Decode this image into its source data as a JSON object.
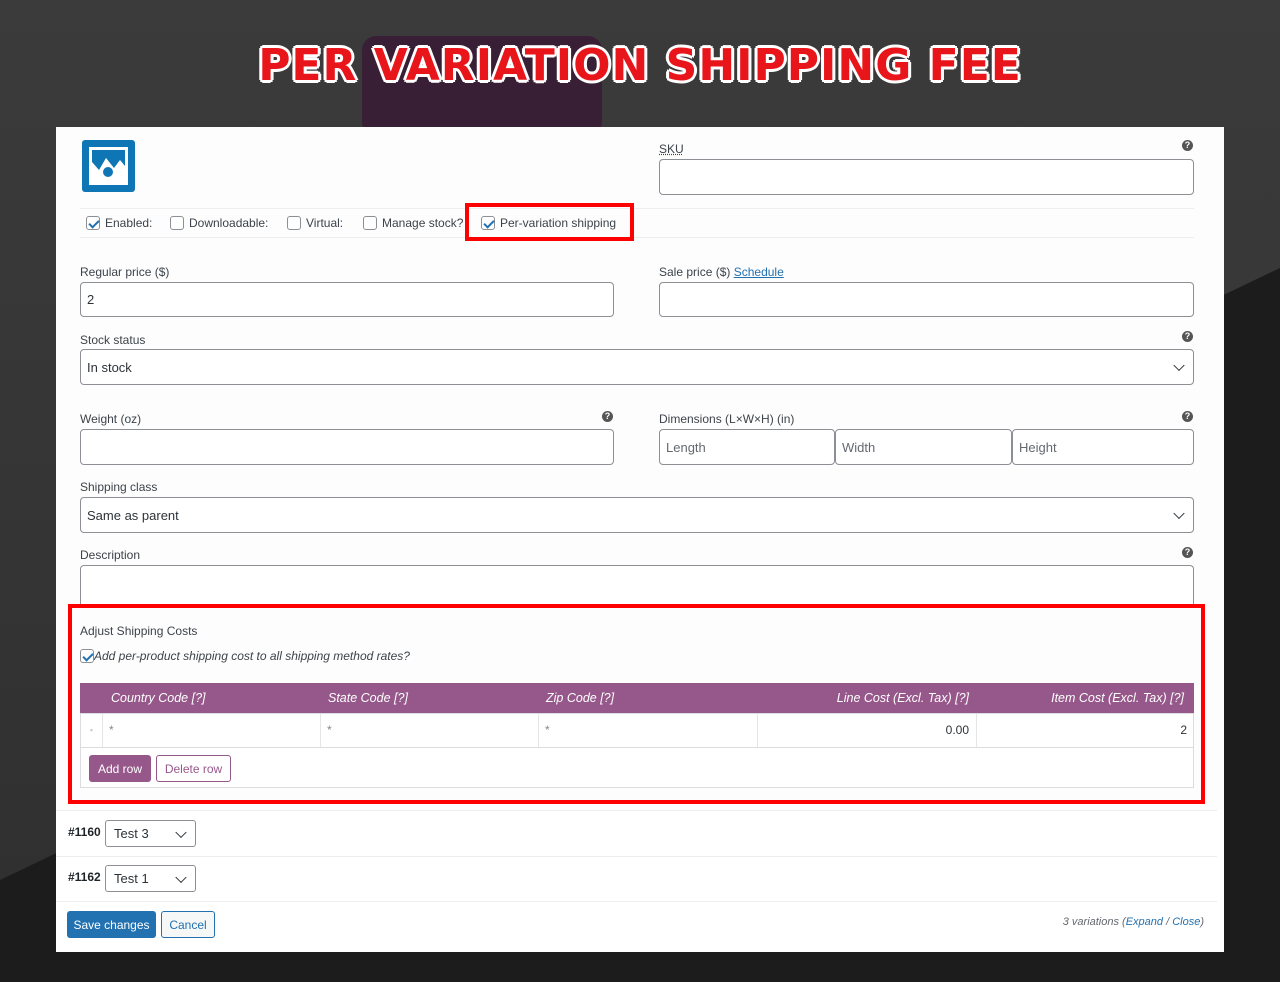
{
  "banner": {
    "title": "PER VARIATION SHIPPING FEE"
  },
  "colors": {
    "accent_red": "#ff0000",
    "woo_purple": "#96588a",
    "wp_blue": "#2271b1"
  },
  "icons": {
    "image_placeholder": "image-placeholder-icon",
    "help": "help-icon",
    "chevron": "chevron-down-icon",
    "drag": "drag-handle-icon"
  },
  "sku": {
    "label": "SKU",
    "value": ""
  },
  "checkboxes": {
    "enabled": {
      "label": "Enabled:",
      "checked": true
    },
    "downloadable": {
      "label": "Downloadable:",
      "checked": false
    },
    "virtual": {
      "label": "Virtual:",
      "checked": false
    },
    "manage_stock": {
      "label": "Manage stock?",
      "checked": false
    },
    "per_variation_shipping": {
      "label": "Per-variation shipping",
      "checked": true
    }
  },
  "regular_price": {
    "label": "Regular price ($)",
    "value": "2"
  },
  "sale_price": {
    "label": "Sale price ($)",
    "schedule_link": "Schedule",
    "value": ""
  },
  "stock_status": {
    "label": "Stock status",
    "value": "In stock"
  },
  "weight": {
    "label": "Weight (oz)",
    "value": ""
  },
  "dimensions": {
    "label": "Dimensions (L×W×H) (in)",
    "length_placeholder": "Length",
    "width_placeholder": "Width",
    "height_placeholder": "Height"
  },
  "shipping_class": {
    "label": "Shipping class",
    "value": "Same as parent"
  },
  "description": {
    "label": "Description",
    "value": ""
  },
  "adjust_shipping": {
    "title": "Adjust Shipping Costs",
    "checkbox_label": "Add per-product shipping cost to all shipping method rates?",
    "checked": true,
    "columns": [
      "Country Code [?]",
      "State Code [?]",
      "Zip Code [?]",
      "Line Cost (Excl. Tax) [?]",
      "Item Cost (Excl. Tax) [?]"
    ],
    "rows": [
      {
        "country": "*",
        "state": "*",
        "zip": "*",
        "line_cost": "0.00",
        "item_cost": "2"
      }
    ],
    "add_row": "Add row",
    "delete_row": "Delete row"
  },
  "variations": [
    {
      "id": "#1160",
      "value": "Test 3"
    },
    {
      "id": "#1162",
      "value": "Test 1"
    }
  ],
  "footer": {
    "save": "Save changes",
    "cancel": "Cancel",
    "count_text": "3 variations (",
    "expand": "Expand",
    "separator": " / ",
    "close": "Close",
    "end": ")"
  }
}
